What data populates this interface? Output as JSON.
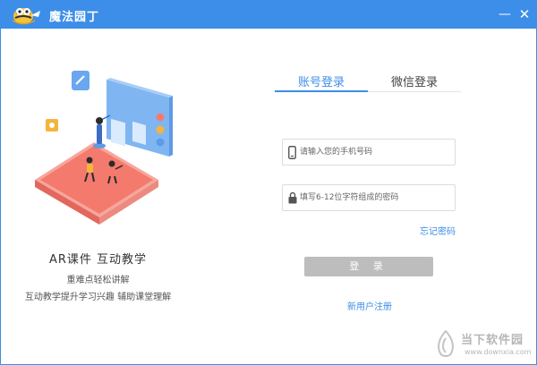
{
  "app": {
    "title": "魔法园丁"
  },
  "window_controls": {
    "minimize": "—",
    "close": "✕"
  },
  "promo": {
    "headline": "AR课件  互动教学",
    "line1": "重难点轻松讲解",
    "line2": "互动教学提升学习兴趣  辅助课堂理解"
  },
  "login": {
    "tabs": [
      {
        "label": "账号登录",
        "active": true
      },
      {
        "label": "微信登录",
        "active": false
      }
    ],
    "phone_placeholder": "请输入您的手机号码",
    "password_placeholder": "填写6-12位字符组成的密码",
    "forgot_label": "忘记密码",
    "submit_label": "登 录",
    "register_label": "新用户注册"
  },
  "watermark": {
    "cn": "当下软件园",
    "en": "www.downxia.com"
  },
  "colors": {
    "accent": "#3d8ee8",
    "button_disabled": "#bdbdbd",
    "platform": "#f47a6e"
  },
  "icons": {
    "phone": "phone-icon",
    "lock": "lock-icon",
    "logo": "bee-logo-icon"
  }
}
